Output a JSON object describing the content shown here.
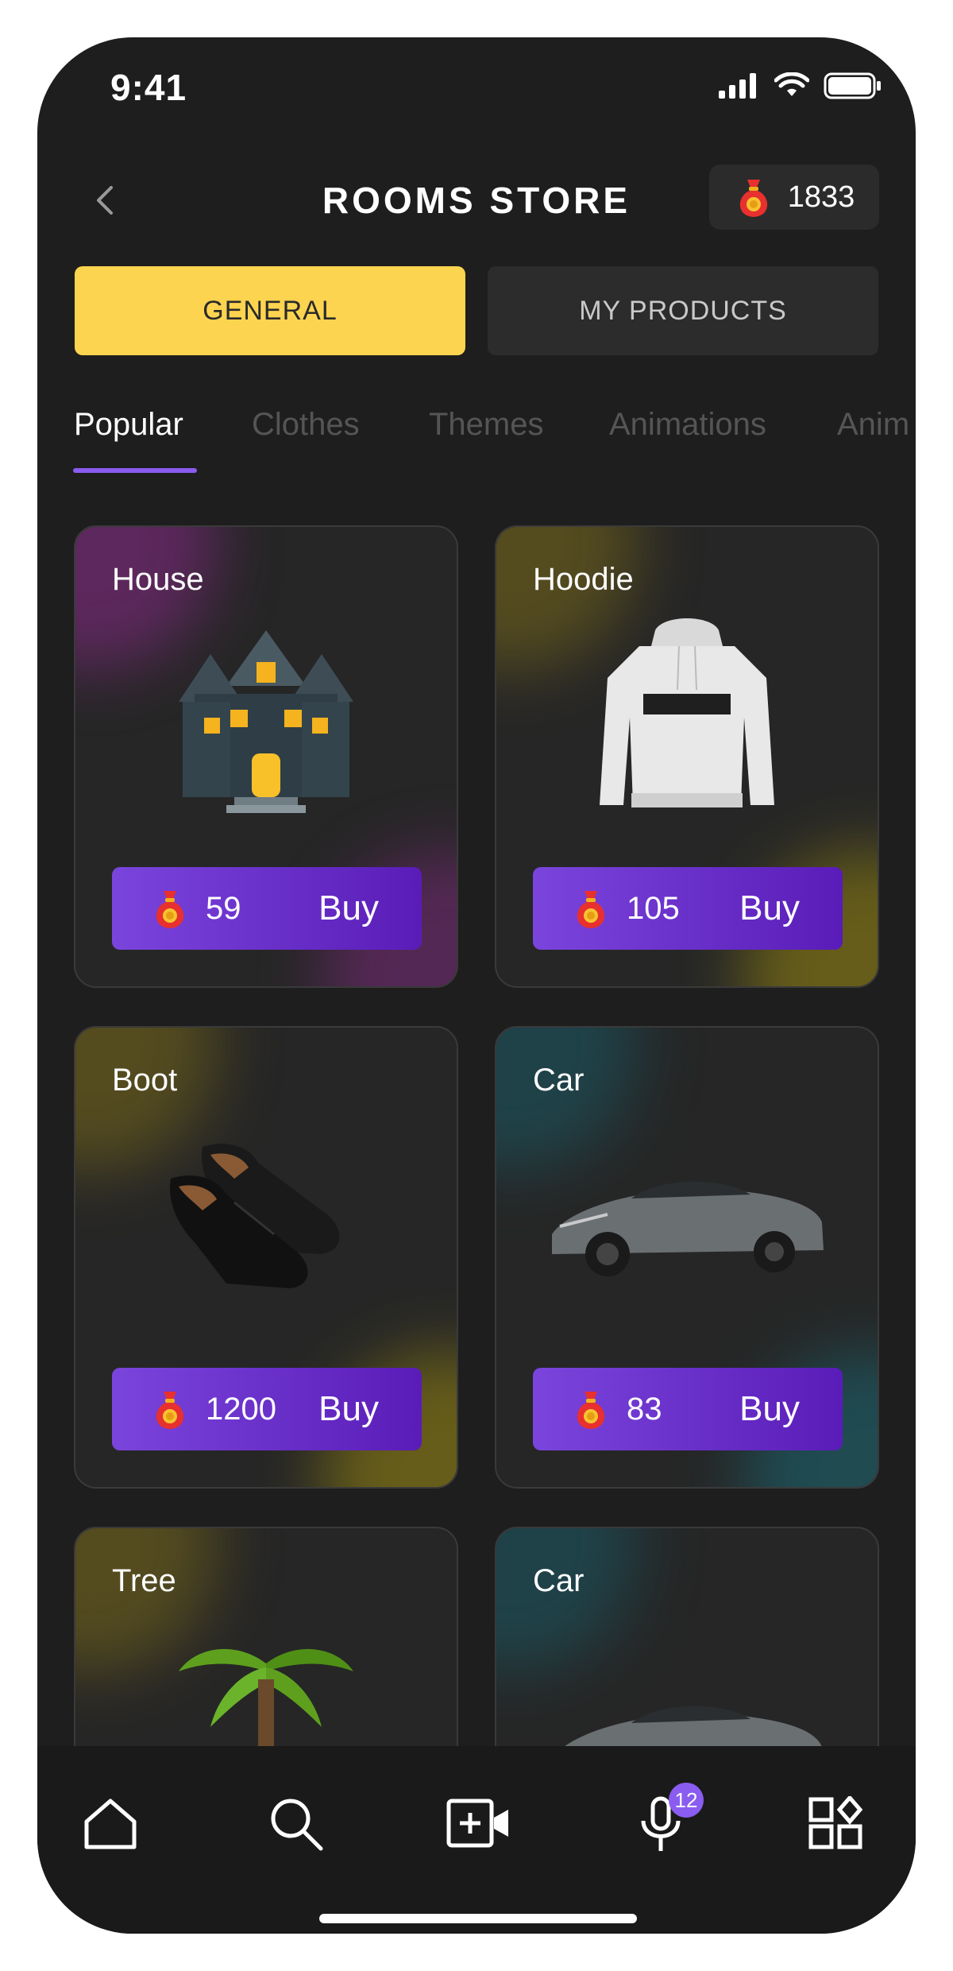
{
  "status_bar": {
    "time": "9:41"
  },
  "header": {
    "title": "ROOMS STORE",
    "coin_balance": "1833"
  },
  "segmented": {
    "general_label": "GENERAL",
    "my_products_label": "MY PRODUCTS"
  },
  "categories": [
    "Popular",
    "Clothes",
    "Themes",
    "Animations",
    "Anim"
  ],
  "products": [
    {
      "name": "House",
      "price": "59",
      "buy_label": "Buy"
    },
    {
      "name": "Hoodie",
      "price": "105",
      "buy_label": "Buy"
    },
    {
      "name": "Boot",
      "price": "1200",
      "buy_label": "Buy"
    },
    {
      "name": "Car",
      "price": "83",
      "buy_label": "Buy"
    },
    {
      "name": "Tree"
    },
    {
      "name": "Car"
    }
  ],
  "nav": {
    "mic_badge": "12"
  },
  "colors": {
    "background": "#1e1e1e",
    "accent_yellow": "#fdd44f",
    "accent_purple": "#7a45dc",
    "tab_indicator": "#8a5cf0"
  },
  "icons": {
    "back": "chevron-left-icon",
    "coin": "money-bag-icon",
    "nav": [
      "home-icon",
      "search-icon",
      "add-video-icon",
      "microphone-icon",
      "apps-grid-icon"
    ]
  }
}
